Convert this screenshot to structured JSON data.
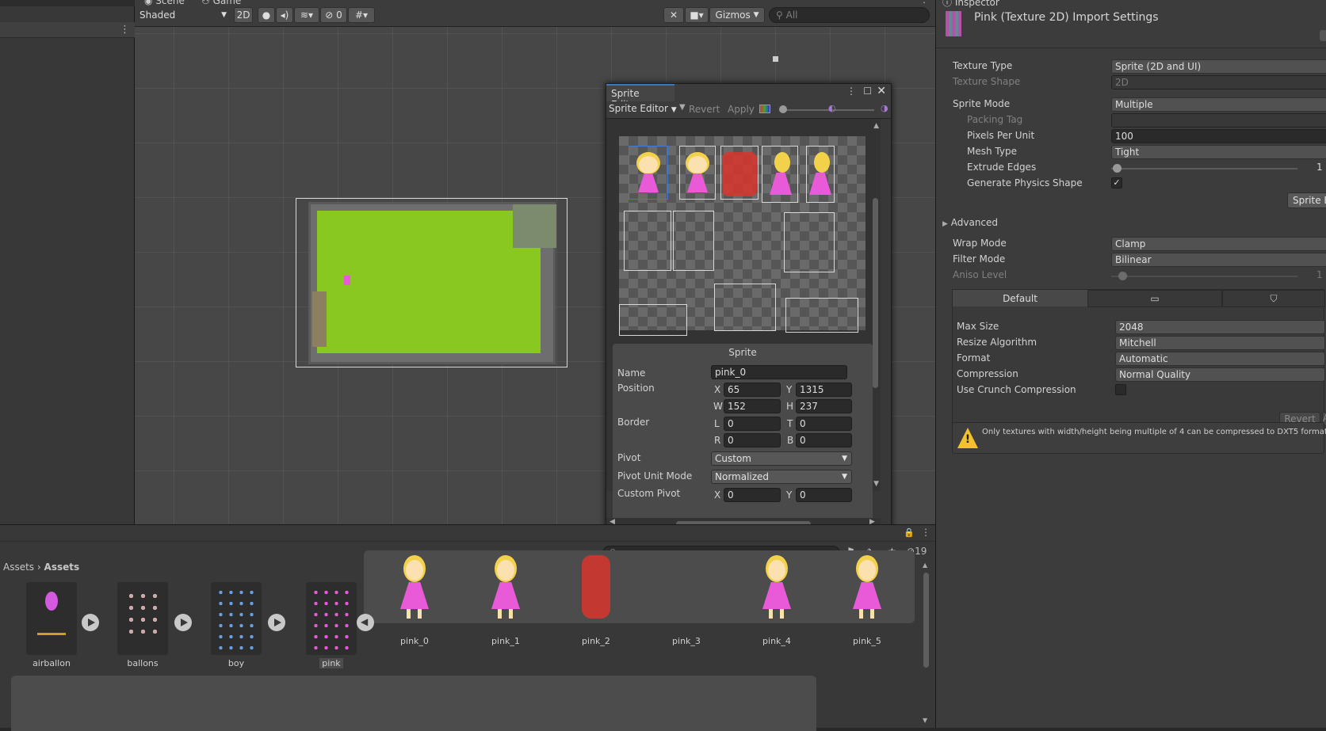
{
  "scene_toolbar": {
    "tabs": [
      "Scene",
      "Game"
    ],
    "shading": "Shaded",
    "mode_2d": "2D",
    "hidden_count": "0",
    "gizmos": "Gizmos",
    "search_placeholder": "All"
  },
  "inspector": {
    "tab": "Inspector",
    "title": "Pink (Texture 2D) Import Settings",
    "rows": {
      "texture_type": {
        "label": "Texture Type",
        "value": "Sprite (2D and UI)"
      },
      "texture_shape": {
        "label": "Texture Shape",
        "value": "2D"
      },
      "sprite_mode": {
        "label": "Sprite Mode",
        "value": "Multiple"
      },
      "packing_tag": {
        "label": "Packing Tag",
        "value": ""
      },
      "pixels_per_unit": {
        "label": "Pixels Per Unit",
        "value": "100"
      },
      "mesh_type": {
        "label": "Mesh Type",
        "value": "Tight"
      },
      "extrude_edges": {
        "label": "Extrude Edges",
        "value": "1",
        "level": 0.03
      },
      "generate_physics": {
        "label": "Generate Physics Shape",
        "checked": true
      },
      "sprite_editor_button": "Sprite E",
      "advanced": "Advanced",
      "wrap_mode": {
        "label": "Wrap Mode",
        "value": "Clamp"
      },
      "filter_mode": {
        "label": "Filter Mode",
        "value": "Bilinear"
      },
      "aniso_level": {
        "label": "Aniso Level",
        "value": "1",
        "level": 0.06
      }
    },
    "platform_tabs": [
      "Default",
      "monitor-icon",
      "html5-icon"
    ],
    "platform": {
      "max_size": {
        "label": "Max Size",
        "value": "2048"
      },
      "resize_algorithm": {
        "label": "Resize Algorithm",
        "value": "Mitchell"
      },
      "format": {
        "label": "Format",
        "value": "Automatic"
      },
      "compression": {
        "label": "Compression",
        "value": "Normal Quality"
      },
      "use_crunch": {
        "label": "Use Crunch Compression",
        "checked": false
      }
    },
    "revert": "Revert",
    "apply_partial": "A",
    "warning": "Only textures with width/height being multiple of 4 can be compressed to DXT5 format"
  },
  "sprite_editor": {
    "title": "Sprite Editor",
    "mode": "Sprite Editor",
    "revert": "Revert",
    "apply": "Apply",
    "panel": {
      "header": "Sprite",
      "name_label": "Name",
      "name": "pink_0",
      "position_label": "Position",
      "x": "65",
      "y": "1315",
      "w": "152",
      "h": "237",
      "border_label": "Border",
      "l": "0",
      "t": "0",
      "r": "0",
      "b": "0",
      "pivot_label": "Pivot",
      "pivot": "Custom",
      "pivot_unit_label": "Pivot Unit Mode",
      "pivot_unit": "Normalized",
      "custom_pivot_label": "Custom Pivot",
      "cx": "0",
      "cy": "0",
      "letters": {
        "x": "X",
        "y": "Y",
        "w": "W",
        "h": "H",
        "l": "L",
        "t": "T",
        "r": "R",
        "b": "B"
      }
    }
  },
  "project": {
    "breadcrumb": [
      "Assets",
      "Assets"
    ],
    "hidden_count": "19",
    "assets": [
      "airballon",
      "ballons",
      "boy",
      "pink"
    ],
    "sprites": [
      "pink_0",
      "pink_1",
      "pink_2",
      "pink_3",
      "pink_4",
      "pink_5"
    ]
  }
}
